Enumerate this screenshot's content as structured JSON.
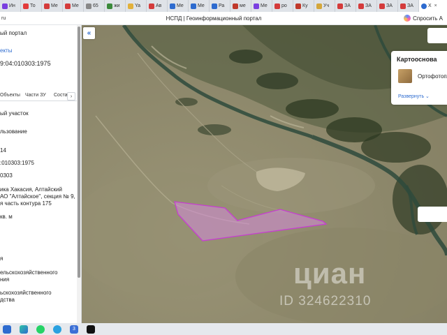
{
  "browser": {
    "tabs": [
      {
        "label": "Ин",
        "color": "#7a3fe0"
      },
      {
        "label": "То",
        "color": "#e23b3b"
      },
      {
        "label": "Ме",
        "color": "#d43b3b"
      },
      {
        "label": "Ме",
        "color": "#d43b3b"
      },
      {
        "label": "65",
        "color": "#888888"
      },
      {
        "label": "жи",
        "color": "#3b8a3b"
      },
      {
        "label": "Ya",
        "color": "#e2b13b"
      },
      {
        "label": "Ав",
        "color": "#d43b3b"
      },
      {
        "label": "Ме",
        "color": "#2d6bcf"
      },
      {
        "label": "Ме",
        "color": "#2d6bcf"
      },
      {
        "label": "Ра",
        "color": "#2d6bcf"
      },
      {
        "label": "ме",
        "color": "#c0392b"
      },
      {
        "label": "Ме",
        "color": "#7a3fe0"
      },
      {
        "label": "ро",
        "color": "#d43b3b"
      },
      {
        "label": "Ку",
        "color": "#c0392b"
      },
      {
        "label": "Уч",
        "color": "#d4a73b"
      },
      {
        "label": "ЗА",
        "color": "#d43b3b"
      },
      {
        "label": "ЗА",
        "color": "#d43b3b"
      },
      {
        "label": "ЗА",
        "color": "#d43b3b"
      },
      {
        "label": "ЗА",
        "color": "#d43b3b"
      }
    ],
    "active_tab": {
      "label": "Х",
      "close": "×"
    },
    "address_prefix": "ru",
    "page_title": "НСПД | Геоинформационный портал",
    "ask_label": "Спросить А"
  },
  "panel": {
    "title": "ый портал",
    "objects_link": "екты",
    "cadastral_number": "9:04:010303:1975",
    "tabs": [
      "Объекты",
      "Части ЗУ",
      "Соста"
    ],
    "arrow": "›",
    "field_type": "ый участок",
    "field_use": "льзование",
    "field_num": "14",
    "field_cad": ":010303:1975",
    "field_quarter": "0303",
    "address_lines": [
      "ика Хакасия, Алтайский",
      "АО \"Алтайское\", секция № 9,",
      "я часть контура 175"
    ],
    "area_unit": "кв. м",
    "status": "я",
    "category_lines": [
      "ельскохозяйственного",
      "ния"
    ],
    "usage_lines": [
      "ьскохозяйственного",
      "дства"
    ]
  },
  "map": {
    "collapse_icon": "«",
    "card_title": "Картооснова",
    "card_option": "Ортофотопл",
    "card_expand": "Развернуть ⌄",
    "watermark_logo": "циан",
    "watermark_id": "ID 324622310",
    "parcel_fill": "#d38bd8",
    "parcel_stroke": "#c63ed0"
  },
  "taskbar": {
    "items": [
      "windows-icon",
      "edge-icon",
      "whatsapp-icon",
      "telegram-icon",
      "calendar-icon",
      "capcut-icon"
    ],
    "calendar_day": "3"
  }
}
